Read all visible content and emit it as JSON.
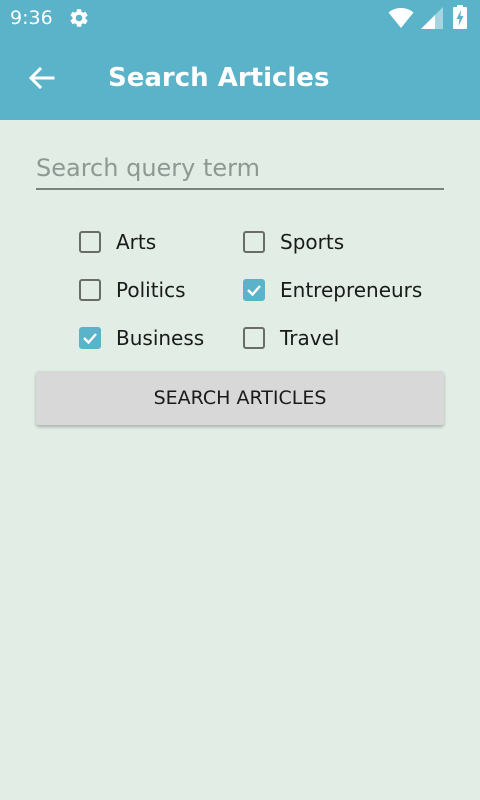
{
  "status_bar": {
    "time": "9:36",
    "icons": [
      "gear-icon",
      "wifi-icon",
      "signal-icon",
      "battery-charging-icon"
    ]
  },
  "app_bar": {
    "back_icon": "arrow-back-icon",
    "title": "Search Articles"
  },
  "search": {
    "placeholder": "Search query term",
    "value": ""
  },
  "categories": [
    {
      "label": "Arts",
      "checked": false
    },
    {
      "label": "Sports",
      "checked": false
    },
    {
      "label": "Politics",
      "checked": false
    },
    {
      "label": "Entrepreneurs",
      "checked": true
    },
    {
      "label": "Business",
      "checked": true
    },
    {
      "label": "Travel",
      "checked": false
    }
  ],
  "search_button": {
    "label": "SEARCH ARTICLES"
  },
  "colors": {
    "accent": "#5bb3c9",
    "background": "#e2ede6",
    "button": "#d8d8d8"
  }
}
